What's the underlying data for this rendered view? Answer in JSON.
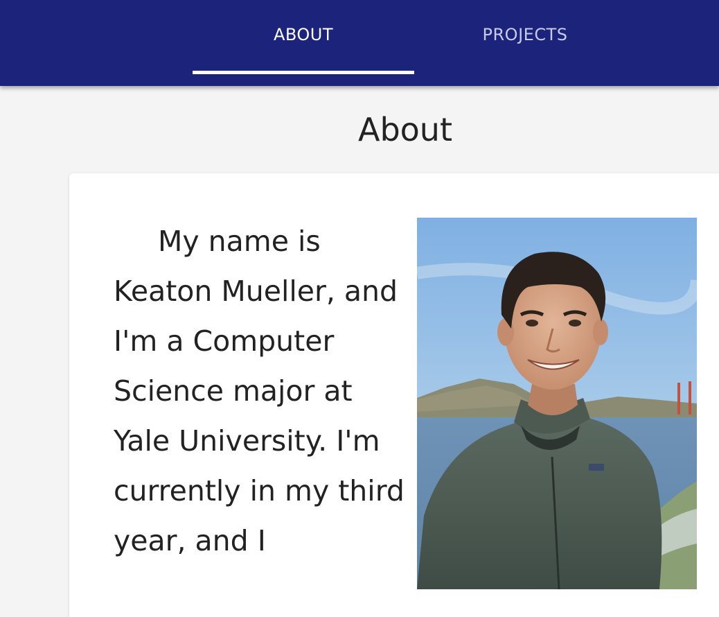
{
  "nav": {
    "tabs": [
      {
        "label": "ABOUT",
        "active": true
      },
      {
        "label": "PROJECTS",
        "active": false
      }
    ]
  },
  "page": {
    "title": "About"
  },
  "about": {
    "bio": "My name is Keaton Mueller, and I'm a Computer Science major at Yale University. I'm currently in my third year, and I",
    "photo_alt": "Portrait photo"
  },
  "colors": {
    "nav_background": "#1b237b",
    "page_background": "#f4f4f4",
    "card_background": "#ffffff"
  }
}
